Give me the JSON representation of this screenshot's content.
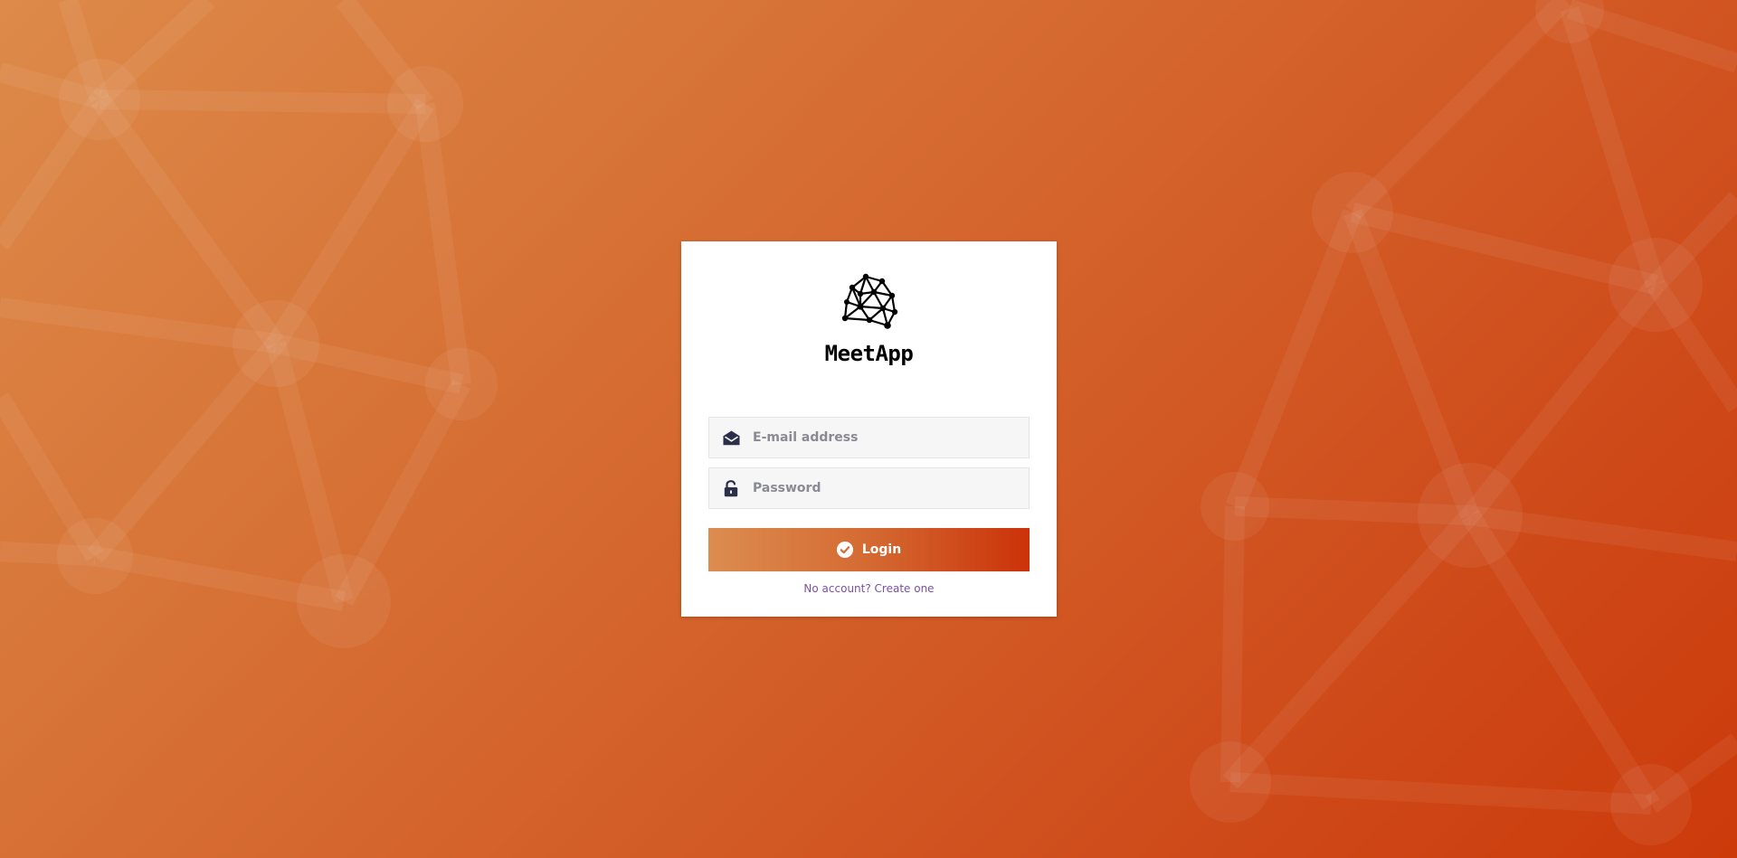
{
  "app": {
    "name": "MeetApp",
    "logo_icon": "network-mesh-icon"
  },
  "form": {
    "email": {
      "placeholder": "E-mail address",
      "value": "",
      "icon": "envelope-open-icon"
    },
    "password": {
      "placeholder": "Password",
      "value": "",
      "icon": "unlock-icon"
    },
    "login_button": {
      "label": "Login",
      "icon": "check-circle-icon"
    },
    "signup_link": "No account? Create one"
  },
  "colors": {
    "background_start": "#dd8a4a",
    "background_end": "#cc3a0a",
    "button_start": "#dc8c50",
    "button_end": "#cb3208",
    "link": "#7b4fa5",
    "icon": "#2c2f4a"
  }
}
